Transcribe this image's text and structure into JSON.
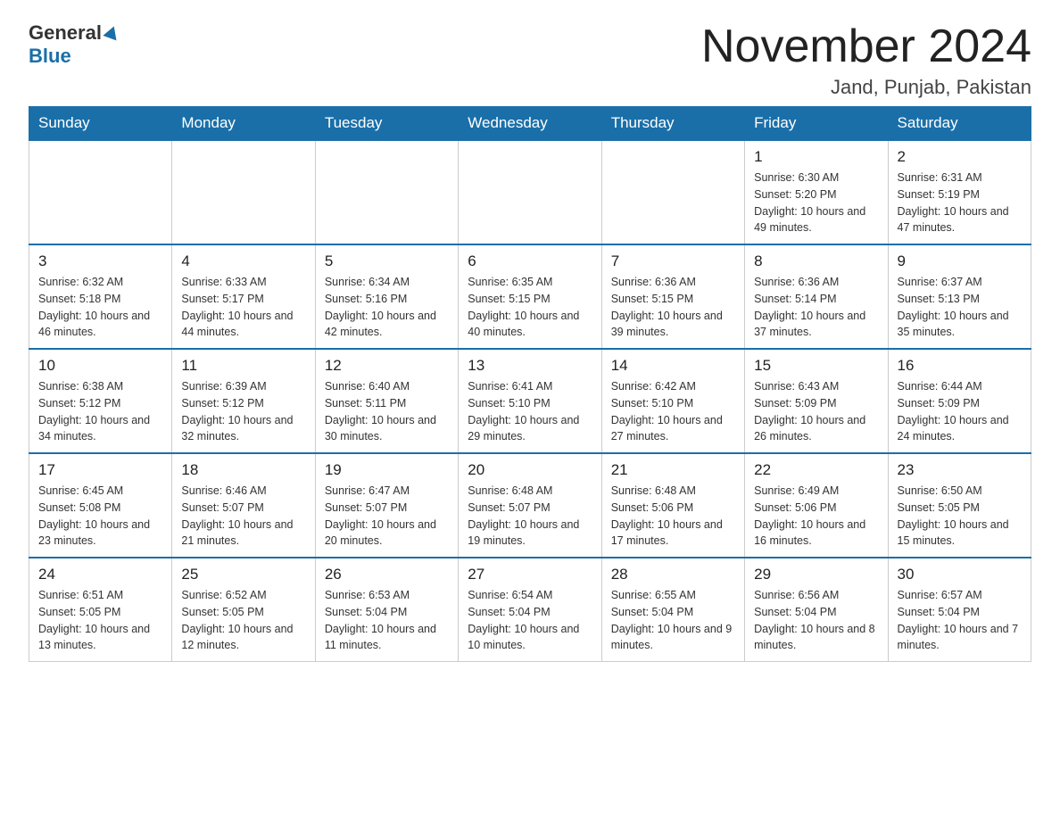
{
  "header": {
    "logo_general": "General",
    "logo_blue": "Blue",
    "title": "November 2024",
    "location": "Jand, Punjab, Pakistan"
  },
  "days_of_week": [
    "Sunday",
    "Monday",
    "Tuesday",
    "Wednesday",
    "Thursday",
    "Friday",
    "Saturday"
  ],
  "weeks": [
    {
      "days": [
        {
          "num": "",
          "info": ""
        },
        {
          "num": "",
          "info": ""
        },
        {
          "num": "",
          "info": ""
        },
        {
          "num": "",
          "info": ""
        },
        {
          "num": "",
          "info": ""
        },
        {
          "num": "1",
          "info": "Sunrise: 6:30 AM\nSunset: 5:20 PM\nDaylight: 10 hours and 49 minutes."
        },
        {
          "num": "2",
          "info": "Sunrise: 6:31 AM\nSunset: 5:19 PM\nDaylight: 10 hours and 47 minutes."
        }
      ]
    },
    {
      "days": [
        {
          "num": "3",
          "info": "Sunrise: 6:32 AM\nSunset: 5:18 PM\nDaylight: 10 hours and 46 minutes."
        },
        {
          "num": "4",
          "info": "Sunrise: 6:33 AM\nSunset: 5:17 PM\nDaylight: 10 hours and 44 minutes."
        },
        {
          "num": "5",
          "info": "Sunrise: 6:34 AM\nSunset: 5:16 PM\nDaylight: 10 hours and 42 minutes."
        },
        {
          "num": "6",
          "info": "Sunrise: 6:35 AM\nSunset: 5:15 PM\nDaylight: 10 hours and 40 minutes."
        },
        {
          "num": "7",
          "info": "Sunrise: 6:36 AM\nSunset: 5:15 PM\nDaylight: 10 hours and 39 minutes."
        },
        {
          "num": "8",
          "info": "Sunrise: 6:36 AM\nSunset: 5:14 PM\nDaylight: 10 hours and 37 minutes."
        },
        {
          "num": "9",
          "info": "Sunrise: 6:37 AM\nSunset: 5:13 PM\nDaylight: 10 hours and 35 minutes."
        }
      ]
    },
    {
      "days": [
        {
          "num": "10",
          "info": "Sunrise: 6:38 AM\nSunset: 5:12 PM\nDaylight: 10 hours and 34 minutes."
        },
        {
          "num": "11",
          "info": "Sunrise: 6:39 AM\nSunset: 5:12 PM\nDaylight: 10 hours and 32 minutes."
        },
        {
          "num": "12",
          "info": "Sunrise: 6:40 AM\nSunset: 5:11 PM\nDaylight: 10 hours and 30 minutes."
        },
        {
          "num": "13",
          "info": "Sunrise: 6:41 AM\nSunset: 5:10 PM\nDaylight: 10 hours and 29 minutes."
        },
        {
          "num": "14",
          "info": "Sunrise: 6:42 AM\nSunset: 5:10 PM\nDaylight: 10 hours and 27 minutes."
        },
        {
          "num": "15",
          "info": "Sunrise: 6:43 AM\nSunset: 5:09 PM\nDaylight: 10 hours and 26 minutes."
        },
        {
          "num": "16",
          "info": "Sunrise: 6:44 AM\nSunset: 5:09 PM\nDaylight: 10 hours and 24 minutes."
        }
      ]
    },
    {
      "days": [
        {
          "num": "17",
          "info": "Sunrise: 6:45 AM\nSunset: 5:08 PM\nDaylight: 10 hours and 23 minutes."
        },
        {
          "num": "18",
          "info": "Sunrise: 6:46 AM\nSunset: 5:07 PM\nDaylight: 10 hours and 21 minutes."
        },
        {
          "num": "19",
          "info": "Sunrise: 6:47 AM\nSunset: 5:07 PM\nDaylight: 10 hours and 20 minutes."
        },
        {
          "num": "20",
          "info": "Sunrise: 6:48 AM\nSunset: 5:07 PM\nDaylight: 10 hours and 19 minutes."
        },
        {
          "num": "21",
          "info": "Sunrise: 6:48 AM\nSunset: 5:06 PM\nDaylight: 10 hours and 17 minutes."
        },
        {
          "num": "22",
          "info": "Sunrise: 6:49 AM\nSunset: 5:06 PM\nDaylight: 10 hours and 16 minutes."
        },
        {
          "num": "23",
          "info": "Sunrise: 6:50 AM\nSunset: 5:05 PM\nDaylight: 10 hours and 15 minutes."
        }
      ]
    },
    {
      "days": [
        {
          "num": "24",
          "info": "Sunrise: 6:51 AM\nSunset: 5:05 PM\nDaylight: 10 hours and 13 minutes."
        },
        {
          "num": "25",
          "info": "Sunrise: 6:52 AM\nSunset: 5:05 PM\nDaylight: 10 hours and 12 minutes."
        },
        {
          "num": "26",
          "info": "Sunrise: 6:53 AM\nSunset: 5:04 PM\nDaylight: 10 hours and 11 minutes."
        },
        {
          "num": "27",
          "info": "Sunrise: 6:54 AM\nSunset: 5:04 PM\nDaylight: 10 hours and 10 minutes."
        },
        {
          "num": "28",
          "info": "Sunrise: 6:55 AM\nSunset: 5:04 PM\nDaylight: 10 hours and 9 minutes."
        },
        {
          "num": "29",
          "info": "Sunrise: 6:56 AM\nSunset: 5:04 PM\nDaylight: 10 hours and 8 minutes."
        },
        {
          "num": "30",
          "info": "Sunrise: 6:57 AM\nSunset: 5:04 PM\nDaylight: 10 hours and 7 minutes."
        }
      ]
    }
  ]
}
